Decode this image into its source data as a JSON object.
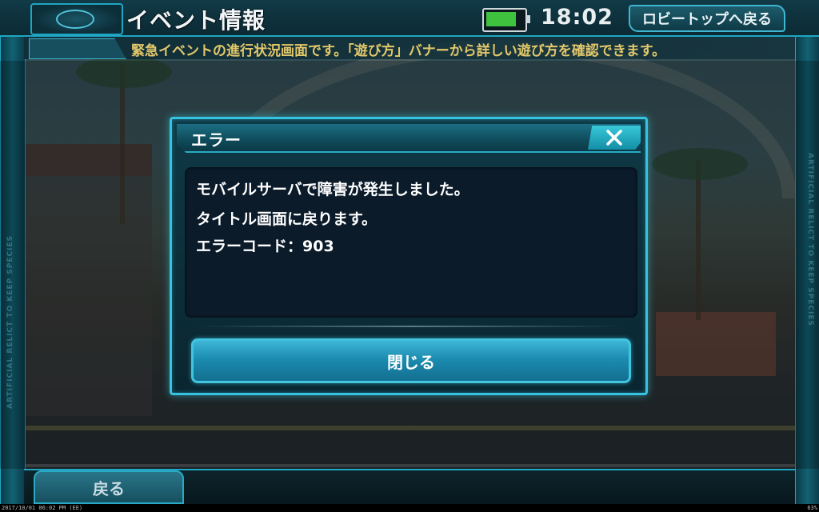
{
  "header": {
    "title": "イベント情報",
    "time": "18:02",
    "battery_level": 0.85,
    "lobby_button_label": "ロビートップへ戻る"
  },
  "info_bar": {
    "message": "緊急イベントの進行状況画面です。「遊び方」バナーから詳しい遊び方を確認できます。"
  },
  "side_rails": {
    "text": "ARTIFICIAL RELICT TO KEEP SPECIES"
  },
  "dialog": {
    "title": "エラー",
    "lines": [
      "モバイルサーバで障害が発生しました。",
      "タイトル画面に戻ります。",
      "エラーコード：903"
    ],
    "button_label": "閉じる"
  },
  "footer": {
    "back_label": "戻る"
  },
  "status_strip": {
    "left": "2017/10/01 06:02 PM (EE)",
    "right": "63%"
  },
  "colors": {
    "accent": "#35c3e0",
    "info_text": "#e3c86a",
    "battery": "#3fc33f"
  }
}
